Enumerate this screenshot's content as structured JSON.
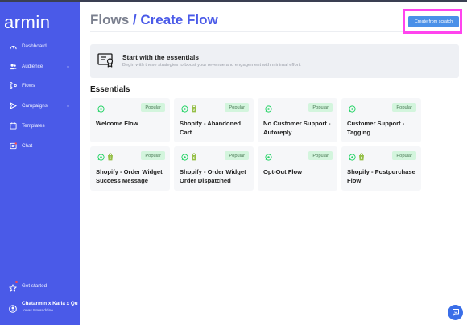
{
  "sidebar": {
    "logo": "armin",
    "items": [
      {
        "label": "Dashboard",
        "icon": "dashboard-icon",
        "has_chevron": false
      },
      {
        "label": "Audience",
        "icon": "audience-icon",
        "has_chevron": true
      },
      {
        "label": "Flows",
        "icon": "flows-icon",
        "has_chevron": false
      },
      {
        "label": "Campaigns",
        "icon": "campaigns-icon",
        "has_chevron": true
      },
      {
        "label": "Templates",
        "icon": "templates-icon",
        "has_chevron": false
      },
      {
        "label": "Chat",
        "icon": "chat-icon",
        "has_chevron": false
      }
    ],
    "chevron": "⌄",
    "get_started": {
      "label": "Get started",
      "icon": "rocket-icon"
    },
    "profile": {
      "name": "Chatarmin x Karla x Qu",
      "email": "Jonas Noureddine",
      "icon": "user-icon"
    }
  },
  "header": {
    "crumb": "Flows",
    "separator": " / ",
    "current": "Create Flow",
    "create_button": "Create from scratch"
  },
  "banner": {
    "heading": "Start with the essentials",
    "text": "Begin with these strategies to boost your revenue and engagement with minimal effort.",
    "icon": "certificate-icon"
  },
  "section_title": "Essentials",
  "cards": [
    {
      "title": "Welcome Flow",
      "badge": "Popular",
      "icons": [
        "whatsapp-icon"
      ]
    },
    {
      "title": "Shopify - Abandoned Cart",
      "badge": "Popular",
      "icons": [
        "whatsapp-icon",
        "shopify-icon"
      ]
    },
    {
      "title": "No Customer Support - Autoreply",
      "badge": "Popular",
      "icons": [
        "whatsapp-icon"
      ]
    },
    {
      "title": "Customer Support - Tagging",
      "badge": "Popular",
      "icons": [
        "whatsapp-icon"
      ]
    },
    {
      "title": "Shopify - Order Widget Success Message",
      "badge": "Popular",
      "icons": [
        "whatsapp-icon",
        "shopify-icon"
      ]
    },
    {
      "title": "Shopify - Order Widget Order Dispatched",
      "badge": "Popular",
      "icons": [
        "whatsapp-icon",
        "shopify-icon"
      ]
    },
    {
      "title": "Opt-Out Flow",
      "badge": "Popular",
      "icons": [
        "whatsapp-icon"
      ]
    },
    {
      "title": "Shopify - Postpurchase Flow",
      "badge": "Popular",
      "icons": [
        "whatsapp-icon",
        "shopify-icon"
      ]
    }
  ],
  "colors": {
    "sidebar": "#4a5ae8",
    "accent": "#4a5ae8",
    "button": "#4a90e8",
    "badge_bg": "#d3f5dd",
    "whatsapp": "#25d366",
    "shopify": "#95bf47",
    "highlight": "#ff44ee"
  },
  "fab_icon": "chat-bubble-icon"
}
